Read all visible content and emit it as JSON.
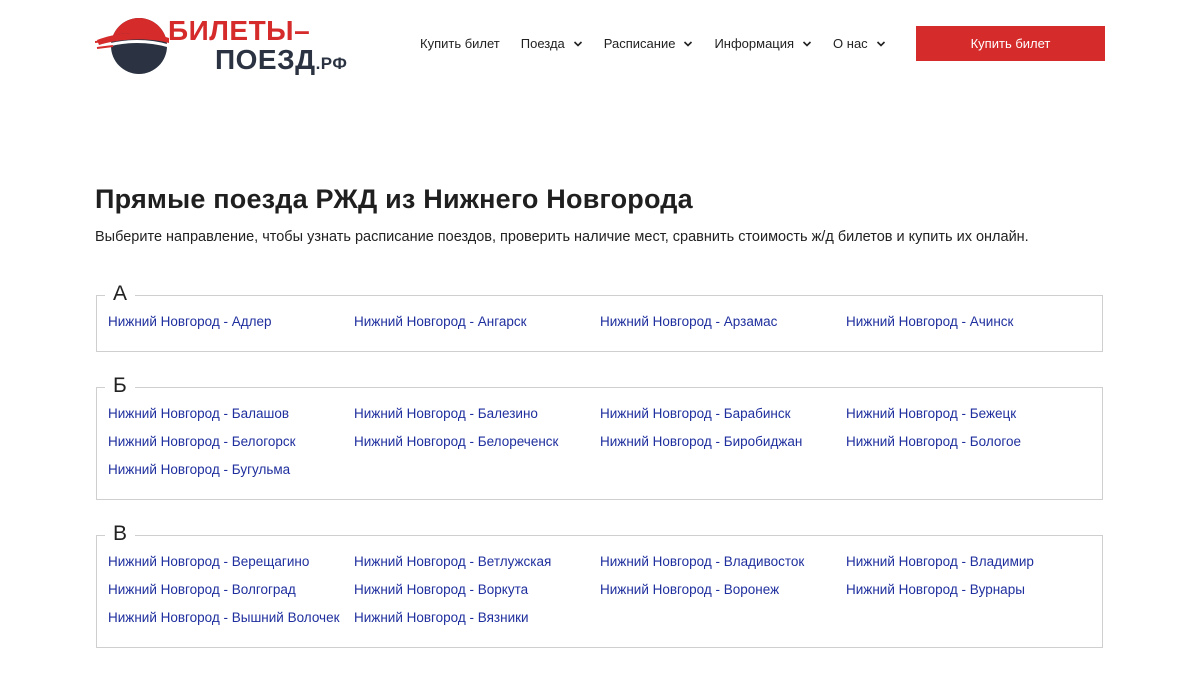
{
  "brand": {
    "line1": "БИЛЕТЫ–",
    "line2": "ПОЕЗД",
    "suffix": ".РФ",
    "colors": {
      "accent": "#d52b2b",
      "dark": "#2b3342"
    }
  },
  "nav": {
    "items": [
      {
        "label": "Купить билет",
        "has_dropdown": false
      },
      {
        "label": "Поезда",
        "has_dropdown": true
      },
      {
        "label": "Расписание",
        "has_dropdown": true
      },
      {
        "label": "Информация",
        "has_dropdown": true
      },
      {
        "label": "О нас",
        "has_dropdown": true
      }
    ],
    "buy_button_label": "Купить билет"
  },
  "main": {
    "title": "Прямые поезда РЖД из Нижнего Новгорода",
    "subtitle": "Выберите направление, чтобы узнать расписание поездов, проверить наличие мест, сравнить стоимость ж/д билетов и купить их онлайн.",
    "link_color": "#1f2f9e",
    "groups": [
      {
        "letter": "А",
        "routes": [
          "Нижний Новгород - Адлер",
          "Нижний Новгород - Ангарск",
          "Нижний Новгород - Арзамас",
          "Нижний Новгород - Ачинск"
        ]
      },
      {
        "letter": "Б",
        "routes": [
          "Нижний Новгород - Балашов",
          "Нижний Новгород - Балезино",
          "Нижний Новгород - Барабинск",
          "Нижний Новгород - Бежецк",
          "Нижний Новгород - Белогорск",
          "Нижний Новгород - Белореченск",
          "Нижний Новгород - Биробиджан",
          "Нижний Новгород - Бологое",
          "Нижний Новгород - Бугульма"
        ]
      },
      {
        "letter": "В",
        "routes": [
          "Нижний Новгород - Верещагино",
          "Нижний Новгород - Ветлужская",
          "Нижний Новгород - Владивосток",
          "Нижний Новгород - Владимир",
          "Нижний Новгород - Волгоград",
          "Нижний Новгород - Воркута",
          "Нижний Новгород - Воронеж",
          "Нижний Новгород - Вурнары",
          "Нижний Новгород - Вышний Волочек",
          "Нижний Новгород - Вязники"
        ]
      }
    ]
  }
}
